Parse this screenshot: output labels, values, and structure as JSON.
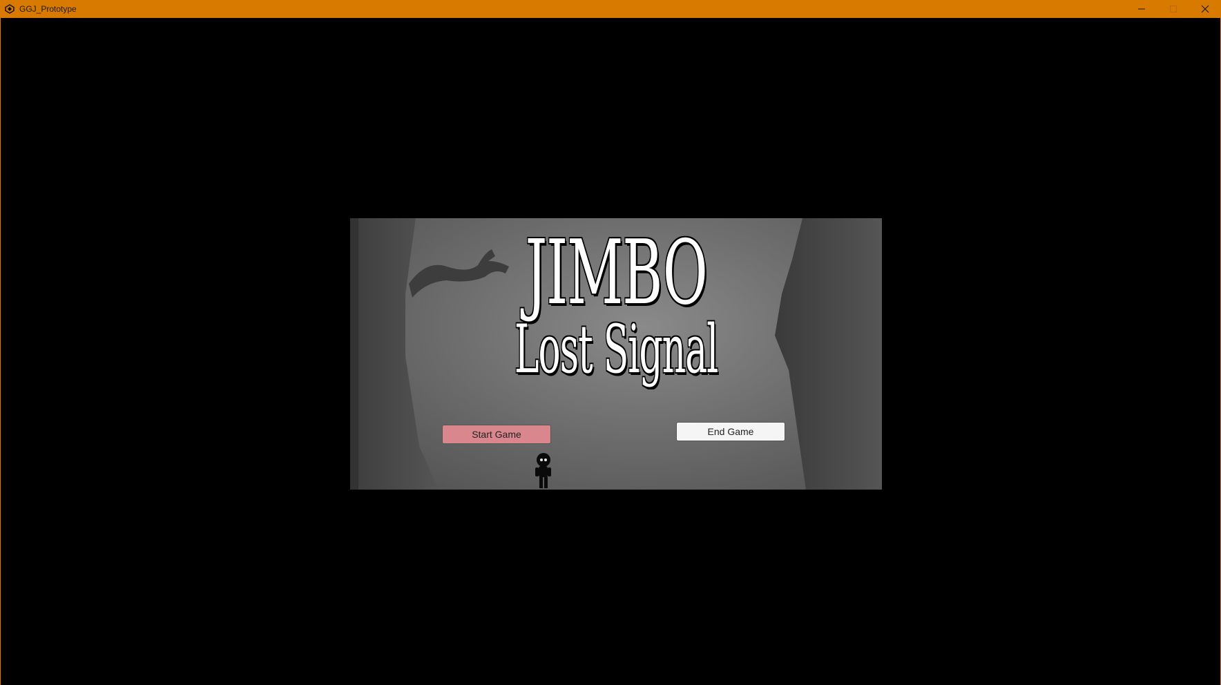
{
  "window": {
    "title": "GGJ_Prototype",
    "app_icon": "unity-icon",
    "controls": {
      "minimize_icon": "minimize-icon",
      "maximize_icon": "maximize-icon",
      "close_icon": "close-icon"
    },
    "titlebar_color": "#d97a00"
  },
  "game": {
    "title_line1": "JIMBO",
    "title_line2": "Lost Signal",
    "start_button": "Start Game",
    "end_button": "End Game",
    "start_button_color": "#d9868c",
    "end_button_color": "#f5f5f5",
    "background_color": "#6e6e6e"
  }
}
